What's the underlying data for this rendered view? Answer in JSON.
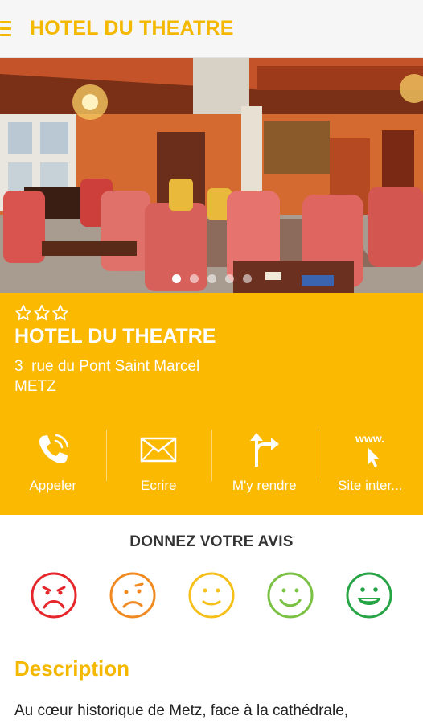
{
  "app_bar": {
    "title": "HOTEL DU THEATRE",
    "menu_icon": "hamburger-menu-icon"
  },
  "hero": {
    "photo": "hotel-lobby-photo",
    "slide_count": 5,
    "active_slide": 1
  },
  "hotel": {
    "stars": 3,
    "name": "HOTEL DU THEATRE",
    "address_line1": "3  rue du Pont Saint Marcel",
    "address_line2": "METZ"
  },
  "actions": [
    {
      "label": "Appeler",
      "icon": "phone-icon"
    },
    {
      "label": "Ecrire",
      "icon": "envelope-icon"
    },
    {
      "label": "M'y rendre",
      "icon": "directions-icon"
    },
    {
      "label": "Site inter...",
      "icon": "website-icon",
      "icon_text": "www."
    }
  ],
  "rating": {
    "title": "DONNEZ VOTRE AVIS",
    "faces": [
      {
        "icon": "very-unhappy-face-icon",
        "color": "#e5272b"
      },
      {
        "icon": "unhappy-face-icon",
        "color": "#f08a20"
      },
      {
        "icon": "neutral-face-icon",
        "color": "#f6bf1a"
      },
      {
        "icon": "happy-face-icon",
        "color": "#7ac143"
      },
      {
        "icon": "very-happy-face-icon",
        "color": "#27a446"
      }
    ]
  },
  "description": {
    "title": "Description",
    "text": "Au cœur historique de Metz, face à la cathédrale,"
  },
  "colors": {
    "accent": "#fbb902",
    "title_accent": "#f5b800"
  }
}
